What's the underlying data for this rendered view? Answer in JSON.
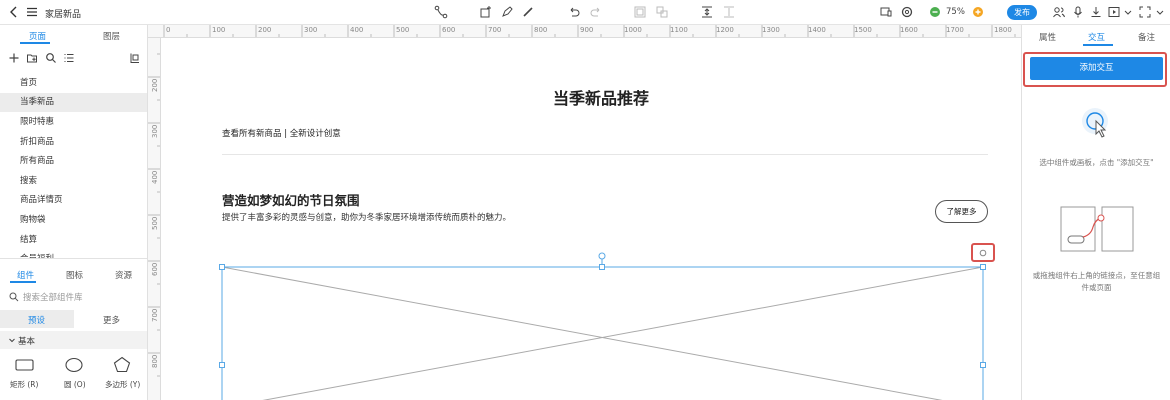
{
  "app": {
    "doc_title": "家居新品",
    "zoom": "75%",
    "publish_label": "发布"
  },
  "left_panel": {
    "tabs": [
      "页面",
      "图层"
    ],
    "pages": [
      "首页",
      "当季新品",
      "限时特惠",
      "折扣商品",
      "所有商品",
      "搜索",
      "商品详情页",
      "购物袋",
      "结算",
      "会员福利"
    ],
    "selected_page": "当季新品",
    "library_tabs": [
      "组件",
      "图标",
      "资源"
    ],
    "search_placeholder": "搜索全部组件库",
    "sub_tabs": [
      "预设",
      "更多"
    ],
    "group_label": "基本",
    "shapes": [
      "矩形 (R)",
      "圆 (O)",
      "多边形 (Y)"
    ]
  },
  "ruler": {
    "h_labels": [
      "0",
      "100",
      "200",
      "300",
      "400",
      "500",
      "600",
      "700",
      "800",
      "900",
      "1000",
      "1100",
      "1200",
      "1300",
      "1400",
      "1500",
      "1600",
      "1700",
      "1800"
    ],
    "v_labels": [
      "200",
      "300",
      "400",
      "500",
      "600",
      "700",
      "800"
    ]
  },
  "canvas": {
    "title": "当季新品推荐",
    "subtitle": "查看所有新商品 | 全新设计创意",
    "section_title": "营造如梦如幻的节日氛围",
    "section_desc": "提供了丰富多彩的灵感与创意，助你为冬季家居环境增添传统而质朴的魅力。",
    "learn_more": "了解更多"
  },
  "right_panel": {
    "tabs": [
      "属性",
      "交互",
      "备注"
    ],
    "active_tab": "交互",
    "add_button": "添加交互",
    "hint_select": "选中组件或画板，点击 \"添加交互\"",
    "hint_drag": "或拖拽组件右上角的链接点，至任意组件或页面"
  },
  "colors": {
    "accent": "#1e88e5",
    "highlight_red": "#d9534f",
    "zoom_dot_green": "#4caf50",
    "zoom_dot_orange": "#f5a623"
  }
}
